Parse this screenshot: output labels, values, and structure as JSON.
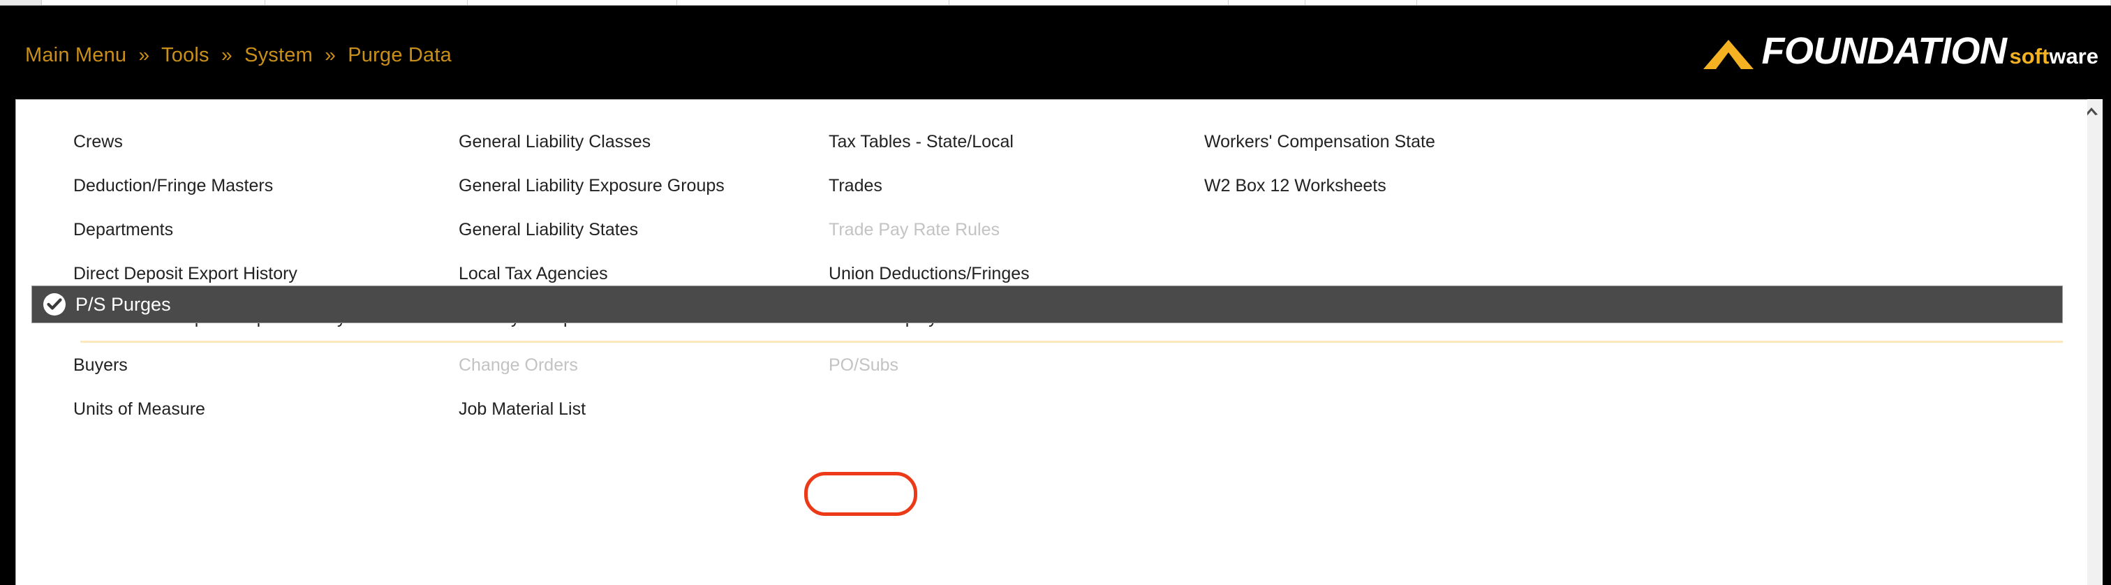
{
  "window": {
    "background_black": "#000000",
    "accent_gold": "#c98f18",
    "logo_yellow": "#f4b223",
    "section_bar_gray": "#4a4a4a",
    "annotation_red": "#ec3a18",
    "divider_cream": "#fbe8bd"
  },
  "breadcrumb": {
    "separator": "»",
    "items": [
      {
        "label": "Main Menu"
      },
      {
        "label": "Tools"
      },
      {
        "label": "System"
      },
      {
        "label": "Purge Data"
      }
    ]
  },
  "logo": {
    "chevron_icon": "chevron-up-icon",
    "word": "FOUNDATION",
    "soft": "soft",
    "ware": "ware"
  },
  "payroll_menu": {
    "columns": [
      {
        "items": [
          {
            "label": "Crews",
            "disabled": false
          },
          {
            "label": "Deduction/Fringe Masters",
            "disabled": false
          },
          {
            "label": "Departments",
            "disabled": false
          },
          {
            "label": "Direct Deposit Export History",
            "disabled": false
          },
          {
            "label": "Contribution Deposit Export History",
            "disabled": false
          }
        ]
      },
      {
        "items": [
          {
            "label": "General Liability Classes",
            "disabled": false
          },
          {
            "label": "General Liability Exposure Groups",
            "disabled": false
          },
          {
            "label": "General Liability States",
            "disabled": false
          },
          {
            "label": "Local Tax Agencies",
            "disabled": false
          },
          {
            "label": "Minority Groups",
            "disabled": false
          }
        ]
      },
      {
        "items": [
          {
            "label": "Tax Tables - State/Local",
            "disabled": false
          },
          {
            "label": "Trades",
            "disabled": false
          },
          {
            "label": "Trade Pay Rate Rules",
            "disabled": true
          },
          {
            "label": "Union Deductions/Fringes",
            "disabled": false
          },
          {
            "label": "Union Employees",
            "disabled": false
          }
        ]
      },
      {
        "items": [
          {
            "label": "Workers' Compensation State",
            "disabled": false
          },
          {
            "label": "W2 Box 12 Worksheets",
            "disabled": false
          }
        ]
      }
    ]
  },
  "ps_purges_section": {
    "icon": "check-circle-icon",
    "title": "P/S Purges",
    "columns": [
      {
        "items": [
          {
            "label": "Buyers",
            "disabled": false
          },
          {
            "label": "Units of Measure",
            "disabled": false
          }
        ]
      },
      {
        "items": [
          {
            "label": "Change Orders",
            "disabled": true
          },
          {
            "label": "Job Material List",
            "disabled": false
          }
        ]
      },
      {
        "items": [
          {
            "label": "PO/Subs",
            "disabled": true
          }
        ]
      }
    ]
  },
  "annotation": {
    "name": "po-subs-highlight",
    "target_label": "PO/Subs"
  },
  "scrollbar": {
    "up_arrow_icon": "chevron-up-icon"
  }
}
